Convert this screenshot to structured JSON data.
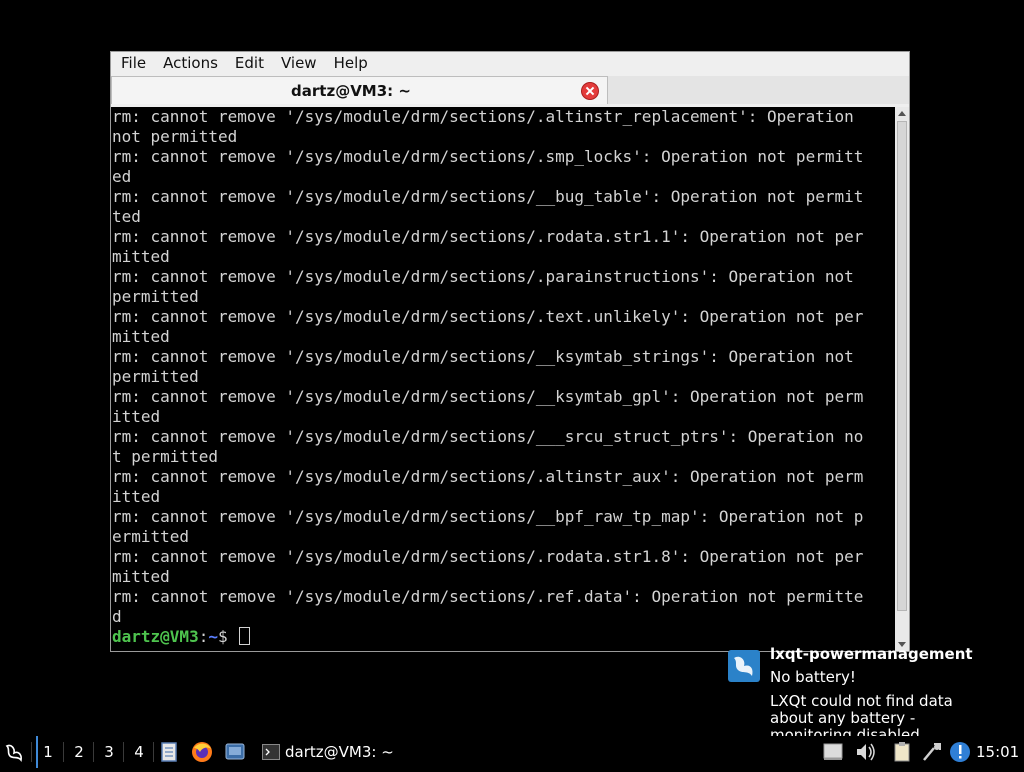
{
  "window": {
    "menu": [
      "File",
      "Actions",
      "Edit",
      "View",
      "Help"
    ],
    "tab_title": "dartz@VM3: ~"
  },
  "terminal": {
    "lines": [
      "rm: cannot remove '/sys/module/drm/sections/.altinstr_replacement': Operation",
      "not permitted",
      "rm: cannot remove '/sys/module/drm/sections/.smp_locks': Operation not permitt",
      "ed",
      "rm: cannot remove '/sys/module/drm/sections/__bug_table': Operation not permit",
      "ted",
      "rm: cannot remove '/sys/module/drm/sections/.rodata.str1.1': Operation not per",
      "mitted",
      "rm: cannot remove '/sys/module/drm/sections/.parainstructions': Operation not",
      "permitted",
      "rm: cannot remove '/sys/module/drm/sections/.text.unlikely': Operation not per",
      "mitted",
      "rm: cannot remove '/sys/module/drm/sections/__ksymtab_strings': Operation not",
      "permitted",
      "rm: cannot remove '/sys/module/drm/sections/__ksymtab_gpl': Operation not perm",
      "itted",
      "rm: cannot remove '/sys/module/drm/sections/___srcu_struct_ptrs': Operation no",
      "t permitted",
      "rm: cannot remove '/sys/module/drm/sections/.altinstr_aux': Operation not perm",
      "itted",
      "rm: cannot remove '/sys/module/drm/sections/__bpf_raw_tp_map': Operation not p",
      "ermitted",
      "rm: cannot remove '/sys/module/drm/sections/.rodata.str1.8': Operation not per",
      "mitted",
      "rm: cannot remove '/sys/module/drm/sections/.ref.data': Operation not permitte",
      "d"
    ],
    "prompt_user": "dartz@VM3",
    "prompt_sep": ":",
    "prompt_path": "~",
    "prompt_symbol": "$"
  },
  "notification": {
    "title": "lxqt-powermanagement",
    "subtitle": "No battery!",
    "body": "LXQt could not find data about any battery - monitoring disabled"
  },
  "panel": {
    "workspaces": [
      "1",
      "2",
      "3",
      "4"
    ],
    "task_label": "dartz@VM3: ~",
    "clock": "15:01"
  },
  "colors": {
    "prompt_user": "#4ec44e",
    "prompt_path": "#5b7fff",
    "close_button": "#e33b3b",
    "notification_icon": "#2b82c9",
    "active_workspace": "#3f8ad8"
  }
}
